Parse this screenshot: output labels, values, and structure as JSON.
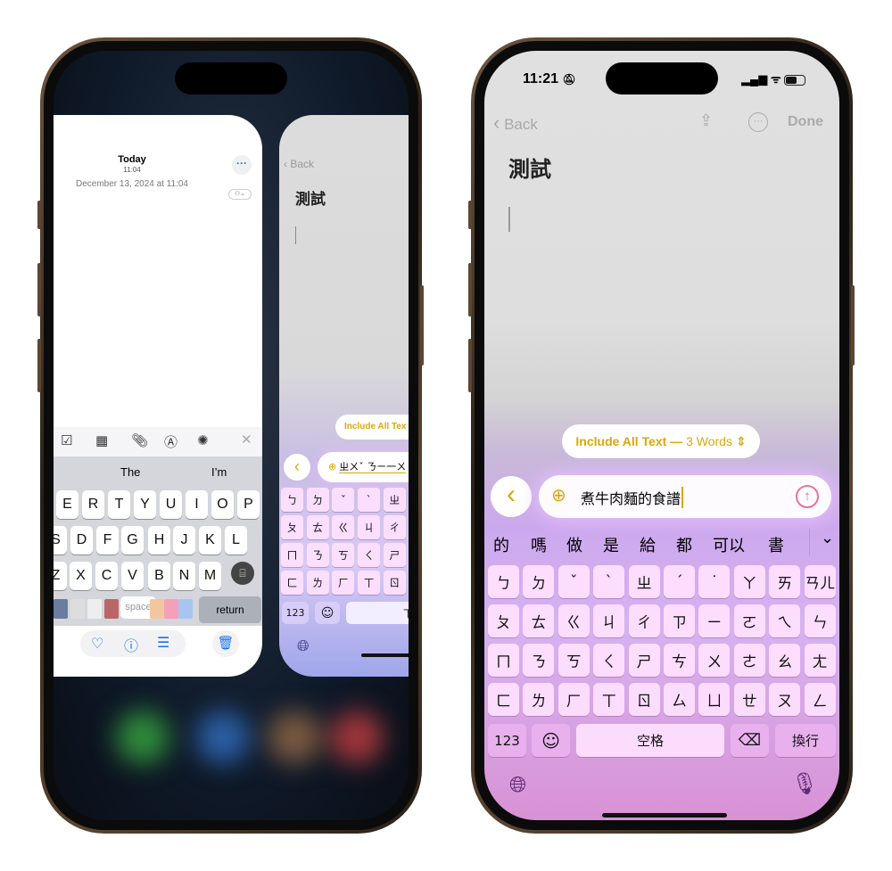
{
  "colors": {
    "accent": "#d9a70b",
    "blue": "#1a73e8",
    "keyboard_top": "#cfa6ef",
    "keyboard_bottom": "#d48fd0"
  },
  "left_phone": {
    "notes_card": {
      "title": "Today",
      "time": "11:04",
      "date": "December 13, 2024 at 11:04",
      "toolbar_icons": [
        "checklist-icon",
        "table-icon",
        "paperclip-icon",
        "pen-icon",
        "writing-tools-icon",
        "close-icon"
      ],
      "suggestions": [
        "The",
        "I’m"
      ],
      "rows": [
        [
          "E",
          "R",
          "T",
          "Y",
          "U",
          "I",
          "O",
          "P"
        ],
        [
          "S",
          "D",
          "F",
          "G",
          "H",
          "J",
          "K",
          "L"
        ],
        [
          "Z",
          "X",
          "C",
          "V",
          "B",
          "N",
          "M"
        ]
      ],
      "space_label": "space",
      "return_label": "return",
      "bottom_icons": [
        "heart-icon",
        "info-icon",
        "sliders-icon",
        "trash-icon"
      ]
    },
    "zhuyin_card": {
      "back_label": "Back",
      "note_title": "測試",
      "pill_label": "Include All Tex",
      "input_text": "ㄓㄨˇ ㄋㄧ一ㄨ",
      "rows": [
        [
          "ㄅ",
          "ㄉ",
          "ˇ",
          "ˋ",
          "ㄓ"
        ],
        [
          "ㄆ",
          "ㄊ",
          "ㄍ",
          "ㄐ",
          "ㄔ"
        ],
        [
          "ㄇ",
          "ㄋ",
          "ㄎ",
          "ㄑ",
          "ㄕ"
        ],
        [
          "ㄈ",
          "ㄌ",
          "ㄏ",
          "ㄒ",
          "ㄖ"
        ]
      ],
      "num_label": "123",
      "next_label": "下一"
    }
  },
  "right_phone": {
    "status": {
      "time": "11:21"
    },
    "nav": {
      "back_label": "Back",
      "done_label": "Done"
    },
    "note_title": "測試",
    "writing_tools": {
      "scope_label": "Include All Text —",
      "scope_count": "3 Words",
      "prompt_text": "煮牛肉麵的食譜"
    },
    "candidates": [
      "的",
      "嗎",
      "做",
      "是",
      "給",
      "都",
      "可以",
      "書"
    ],
    "rows": [
      [
        "ㄅ",
        "ㄉ",
        "ˇ",
        "ˋ",
        "ㄓ",
        "ˊ",
        "˙",
        "ㄚ",
        "ㄞ",
        "ㄢㄦ"
      ],
      [
        "ㄆ",
        "ㄊ",
        "ㄍ",
        "ㄐ",
        "ㄔ",
        "ㄗ",
        "ㄧ",
        "ㄛ",
        "ㄟ",
        "ㄣ"
      ],
      [
        "ㄇ",
        "ㄋ",
        "ㄎ",
        "ㄑ",
        "ㄕ",
        "ㄘ",
        "ㄨ",
        "ㄜ",
        "ㄠ",
        "ㄤ"
      ],
      [
        "ㄈ",
        "ㄌ",
        "ㄏ",
        "ㄒ",
        "ㄖ",
        "ㄙ",
        "ㄩ",
        "ㄝ",
        "ㄡ",
        "ㄥ"
      ]
    ],
    "bottom_row": {
      "num_label": "123",
      "space_label": "空格",
      "return_label": "換行"
    }
  }
}
